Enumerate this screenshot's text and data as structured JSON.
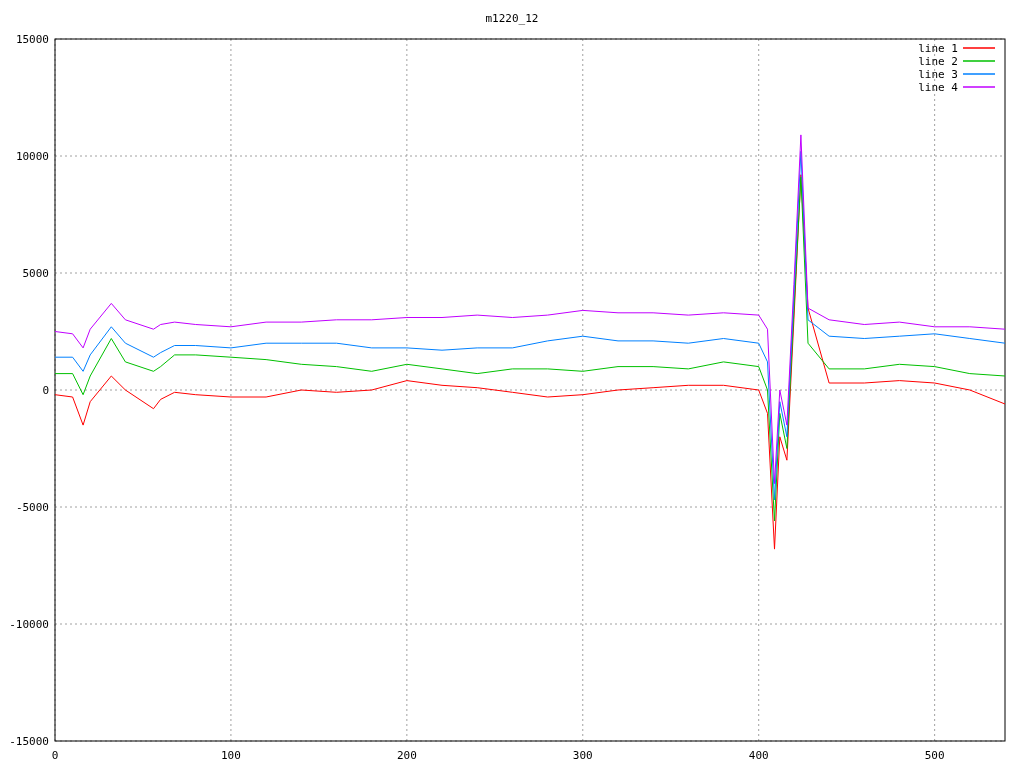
{
  "chart_data": {
    "type": "line",
    "title": "m1220_12",
    "x": [
      0,
      10,
      16,
      20,
      32,
      40,
      56,
      60,
      68,
      80,
      100,
      120,
      140,
      160,
      180,
      200,
      220,
      240,
      260,
      280,
      300,
      320,
      340,
      360,
      380,
      400,
      405,
      409,
      412,
      416,
      420,
      424,
      428,
      440,
      460,
      480,
      500,
      520,
      540
    ],
    "series": [
      {
        "name": "line 1",
        "color": "#ff0000",
        "values": [
          -200,
          -300,
          -1500,
          -500,
          600,
          0,
          -800,
          -400,
          -100,
          -200,
          -300,
          -300,
          0,
          -100,
          0,
          400,
          200,
          100,
          -100,
          -300,
          -200,
          0,
          100,
          200,
          200,
          0,
          -1000,
          -6800,
          -2000,
          -3000,
          3000,
          9200,
          3500,
          300,
          300,
          400,
          300,
          0,
          -600
        ]
      },
      {
        "name": "line 2",
        "color": "#00c000",
        "values": [
          700,
          700,
          -200,
          600,
          2200,
          1200,
          800,
          1000,
          1500,
          1500,
          1400,
          1300,
          1100,
          1000,
          800,
          1100,
          900,
          700,
          900,
          900,
          800,
          1000,
          1000,
          900,
          1200,
          1000,
          0,
          -5600,
          -1000,
          -2500,
          3400,
          9100,
          2000,
          900,
          900,
          1100,
          1000,
          700,
          600
        ]
      },
      {
        "name": "line 3",
        "color": "#0080ff",
        "values": [
          1400,
          1400,
          800,
          1500,
          2700,
          2000,
          1400,
          1600,
          1900,
          1900,
          1800,
          2000,
          2000,
          2000,
          1800,
          1800,
          1700,
          1800,
          1800,
          2100,
          2300,
          2100,
          2100,
          2000,
          2200,
          2000,
          1200,
          -4700,
          -500,
          -2000,
          4000,
          10200,
          3000,
          2300,
          2200,
          2300,
          2400,
          2200,
          2000
        ]
      },
      {
        "name": "line 4",
        "color": "#c000ff",
        "values": [
          2500,
          2400,
          1800,
          2600,
          3700,
          3000,
          2600,
          2800,
          2900,
          2800,
          2700,
          2900,
          2900,
          3000,
          3000,
          3100,
          3100,
          3200,
          3100,
          3200,
          3400,
          3300,
          3300,
          3200,
          3300,
          3200,
          2600,
          -4000,
          0,
          -1500,
          4500,
          10900,
          3500,
          3000,
          2800,
          2900,
          2700,
          2700,
          2600
        ]
      }
    ],
    "grid": true,
    "legend": true,
    "xlim": [
      0,
      540
    ],
    "ylim": [
      -15000,
      15000
    ],
    "xticks": [
      0,
      100,
      200,
      300,
      400,
      500
    ],
    "yticks": [
      -15000,
      -10000,
      -5000,
      0,
      5000,
      10000,
      15000
    ]
  }
}
